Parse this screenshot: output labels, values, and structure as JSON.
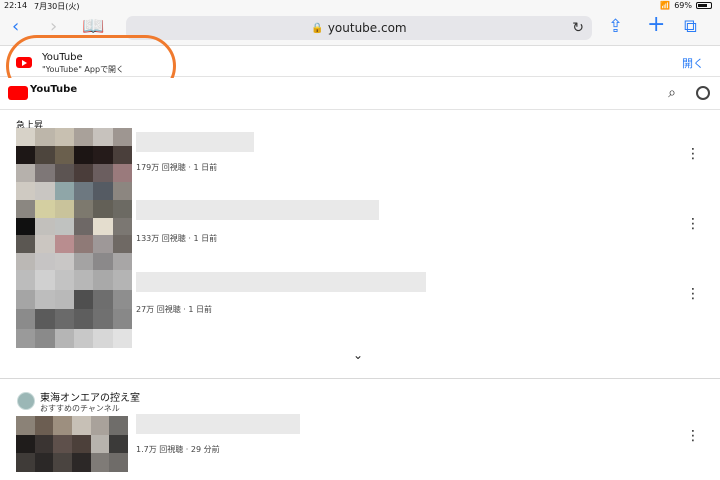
{
  "status_bar": {
    "time": "22:14",
    "date": "7月30日(火)",
    "battery": "69%"
  },
  "browser": {
    "url": "youtube.com"
  },
  "app_banner": {
    "title": "YouTube",
    "subtitle": "\"YouTube\" Appで開く",
    "open_label": "開く"
  },
  "youtube_header": {
    "logo_text": "YouTube"
  },
  "trending": {
    "title": "急上昇",
    "videos": [
      {
        "meta": "179万 回視聴 · 1 日前"
      },
      {
        "meta": "133万 回視聴 · 1 日前"
      },
      {
        "meta": "27万 回視聴 · 1 日前"
      }
    ]
  },
  "channel": {
    "name": "東海オンエアの控え室",
    "subtitle": "おすすめのチャンネル",
    "videos": [
      {
        "meta": "1.7万 回視聴 · 29 分前"
      }
    ]
  },
  "colors": {
    "accent": "#2b7cf6",
    "youtube_red": "#ff0000",
    "annotation_orange": "#f07a2e"
  }
}
